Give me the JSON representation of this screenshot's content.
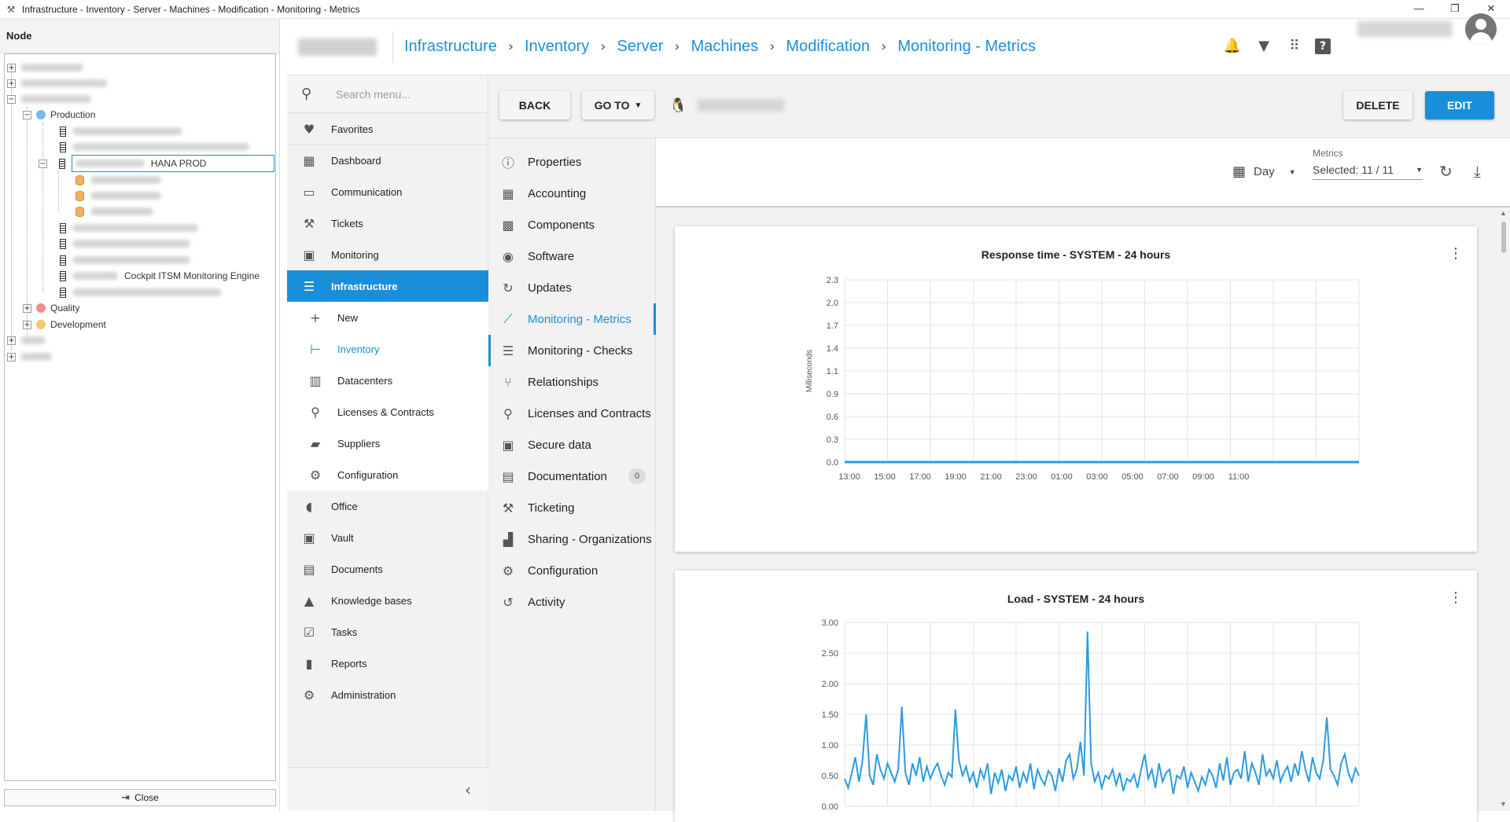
{
  "window": {
    "title": "Infrastructure - Inventory - Server - Machines - Modification - Monitoring - Metrics",
    "minimize": "—",
    "maximize": "❐",
    "close": "✕"
  },
  "tree": {
    "header": "Node",
    "production_label": "Production",
    "hana_label": "HANA PROD",
    "cockpit_label": "Cockpit ITSM Monitoring Engine",
    "quality_label": "Quality",
    "development_label": "Development",
    "close_label": "Close",
    "colors": {
      "production": "#7ab8ec",
      "quality": "#ef8d8d",
      "development": "#f5c96a"
    }
  },
  "breadcrumb": [
    "Infrastructure",
    "Inventory",
    "Server",
    "Machines",
    "Modification",
    "Monitoring - Metrics"
  ],
  "top_icons": [
    "bell-icon",
    "filter-icon",
    "apps-grid-icon",
    "help-icon"
  ],
  "menu": {
    "search_placeholder": "Search menu...",
    "items": [
      {
        "label": "Favorites",
        "icon": "heart-icon"
      },
      {
        "label": "Dashboard",
        "icon": "dashboard-icon"
      },
      {
        "label": "Communication",
        "icon": "chat-icon"
      },
      {
        "label": "Tickets",
        "icon": "hammer-icon"
      },
      {
        "label": "Monitoring",
        "icon": "monitor-icon"
      },
      {
        "label": "Infrastructure",
        "icon": "server-icon"
      },
      {
        "label": "New",
        "icon": "plus-icon"
      },
      {
        "label": "Inventory",
        "icon": "tree-icon"
      },
      {
        "label": "Datacenters",
        "icon": "building-icon"
      },
      {
        "label": "Licenses & Contracts",
        "icon": "award-icon"
      },
      {
        "label": "Suppliers",
        "icon": "truck-icon"
      },
      {
        "label": "Configuration",
        "icon": "gear-icon"
      },
      {
        "label": "Office",
        "icon": "mouse-icon"
      },
      {
        "label": "Vault",
        "icon": "vault-icon"
      },
      {
        "label": "Documents",
        "icon": "book-icon"
      },
      {
        "label": "Knowledge bases",
        "icon": "graduation-icon"
      },
      {
        "label": "Tasks",
        "icon": "checkbox-icon"
      },
      {
        "label": "Reports",
        "icon": "bar-chart-icon"
      },
      {
        "label": "Administration",
        "icon": "gear-icon"
      }
    ]
  },
  "actions": {
    "back": "BACK",
    "goto": "GO TO",
    "delete": "DELETE",
    "edit": "EDIT"
  },
  "sections": [
    {
      "label": "Properties",
      "icon": "info-icon"
    },
    {
      "label": "Accounting",
      "icon": "calculator-icon"
    },
    {
      "label": "Components",
      "icon": "chip-icon"
    },
    {
      "label": "Software",
      "icon": "disc-icon"
    },
    {
      "label": "Updates",
      "icon": "update-icon"
    },
    {
      "label": "Monitoring - Metrics",
      "icon": "line-chart-icon"
    },
    {
      "label": "Monitoring - Checks",
      "icon": "checklist-icon"
    },
    {
      "label": "Relationships",
      "icon": "fork-icon"
    },
    {
      "label": "Licenses and Contracts",
      "icon": "award-icon"
    },
    {
      "label": "Secure data",
      "icon": "vault-icon"
    },
    {
      "label": "Documentation",
      "icon": "book-icon",
      "badge": "0"
    },
    {
      "label": "Ticketing",
      "icon": "hammer-icon"
    },
    {
      "label": "Sharing - Organizations",
      "icon": "factory-icon"
    },
    {
      "label": "Configuration",
      "icon": "gear-icon"
    },
    {
      "label": "Activity",
      "icon": "history-icon"
    }
  ],
  "toolbar": {
    "period": "Day",
    "metrics_label": "Metrics",
    "metrics_value": "Selected: 11 / 11"
  },
  "chart_data": [
    {
      "type": "line",
      "title": "Response time - SYSTEM - 24 hours",
      "ylabel": "Milliseconds",
      "xlabel": "",
      "x_ticks": [
        "13:00",
        "15:00",
        "17:00",
        "19:00",
        "21:00",
        "23:00",
        "01:00",
        "03:00",
        "05:00",
        "07:00",
        "09:00",
        "11:00"
      ],
      "y_ticks": [
        "0.0",
        "0.3",
        "0.6",
        "0.9",
        "1.1",
        "1.4",
        "1.7",
        "2.0",
        "2.3"
      ],
      "ylim": [
        0,
        2.3
      ],
      "grid": true,
      "color": "#2b9be0",
      "series": [
        {
          "values": [
            0,
            0,
            0,
            0,
            0,
            0,
            0,
            0,
            0,
            0,
            0,
            0,
            0,
            0,
            0,
            0,
            0,
            0,
            0,
            0,
            0,
            0,
            0,
            0,
            0,
            0,
            0,
            0,
            0,
            0,
            0,
            0,
            0,
            0,
            0,
            0,
            0,
            0,
            0,
            0,
            0,
            0,
            0,
            0,
            0,
            0,
            0,
            0
          ]
        }
      ]
    },
    {
      "type": "line",
      "title": "Load - SYSTEM - 24 hours",
      "ylabel": "",
      "xlabel": "",
      "y_ticks": [
        "0.00",
        "0.50",
        "1.00",
        "1.50",
        "2.00",
        "2.50",
        "3.00"
      ],
      "ylim": [
        0,
        3
      ],
      "grid": true,
      "color": "#2b9be0",
      "series": [
        {
          "values": [
            0.45,
            0.3,
            0.55,
            0.8,
            0.4,
            0.75,
            1.5,
            0.5,
            0.35,
            0.85,
            0.6,
            0.45,
            0.7,
            0.55,
            0.4,
            0.6,
            1.62,
            0.55,
            0.35,
            0.7,
            0.5,
            0.8,
            0.4,
            0.65,
            0.45,
            0.6,
            0.7,
            0.5,
            0.35,
            0.55,
            0.48,
            1.58,
            0.75,
            0.5,
            0.65,
            0.4,
            0.55,
            0.3,
            0.6,
            0.45,
            0.7,
            0.2,
            0.55,
            0.38,
            0.6,
            0.25,
            0.5,
            0.42,
            0.65,
            0.3,
            0.55,
            0.4,
            0.7,
            0.28,
            0.6,
            0.45,
            0.35,
            0.58,
            0.5,
            0.25,
            0.62,
            0.4,
            0.75,
            0.85,
            0.45,
            0.6,
            1.05,
            0.5,
            2.85,
            0.7,
            0.4,
            0.55,
            0.3,
            0.5,
            0.45,
            0.6,
            0.35,
            0.55,
            0.25,
            0.45,
            0.4,
            0.52,
            0.3,
            0.6,
            0.85,
            0.45,
            0.6,
            0.3,
            0.7,
            0.4,
            0.55,
            0.6,
            0.2,
            0.5,
            0.45,
            0.65,
            0.3,
            0.55,
            0.4,
            0.25,
            0.48,
            0.35,
            0.6,
            0.5,
            0.3,
            0.7,
            0.42,
            0.8,
            0.35,
            0.55,
            0.6,
            0.45,
            0.9,
            0.4,
            0.7,
            0.55,
            0.35,
            0.85,
            0.5,
            0.6,
            0.45,
            0.75,
            0.4,
            0.55,
            0.65,
            0.4,
            0.7,
            0.5,
            0.9,
            0.6,
            0.4,
            0.8,
            0.55,
            0.45,
            0.75,
            1.45,
            0.6,
            0.5,
            0.35,
            0.7,
            0.85,
            0.55,
            0.4,
            0.62,
            0.5
          ]
        }
      ]
    }
  ]
}
